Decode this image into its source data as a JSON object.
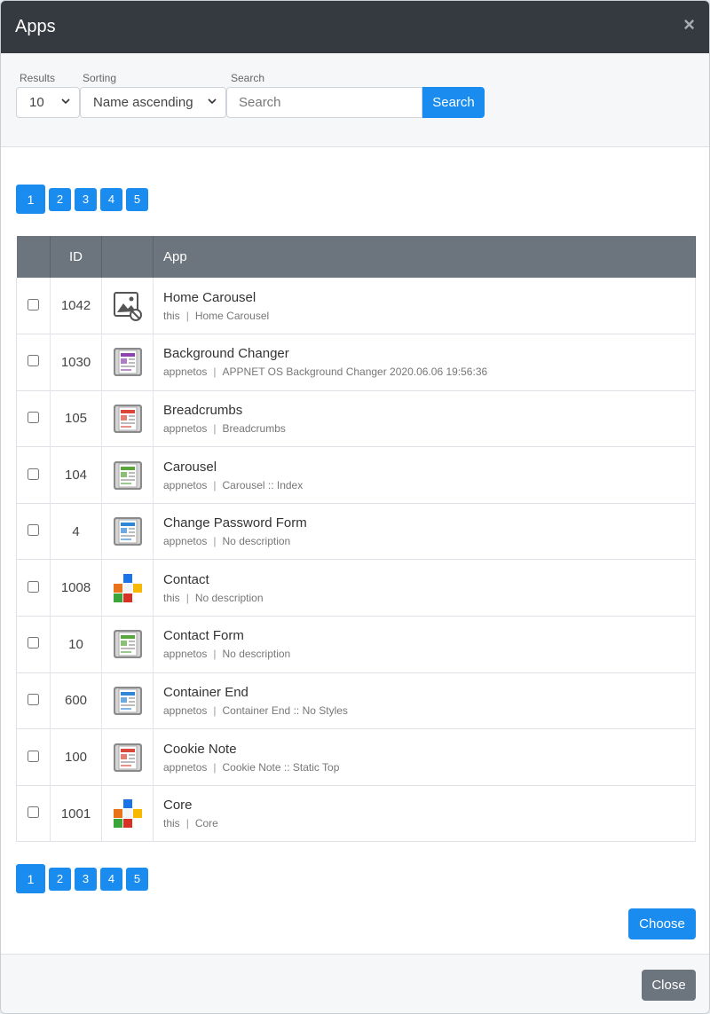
{
  "modal": {
    "title": "Apps",
    "close_glyph": "×"
  },
  "filters": {
    "results_label": "Results",
    "results_value": "10",
    "sorting_label": "Sorting",
    "sorting_value": "Name ascending",
    "search_label": "Search",
    "search_placeholder": "Search",
    "search_button": "Search"
  },
  "pagination": {
    "pages": [
      "1",
      "2",
      "3",
      "4",
      "5"
    ],
    "current": "1"
  },
  "table": {
    "headers": {
      "select": "",
      "id": "ID",
      "icon": "",
      "app": "App"
    },
    "separator": "|",
    "rows": [
      {
        "id": "1042",
        "name": "Home Carousel",
        "vendor": "this",
        "description": "Home Carousel",
        "icon": "image-missing-icon"
      },
      {
        "id": "1030",
        "name": "Background Changer",
        "vendor": "appnetos",
        "description": "APPNET OS Background Changer 2020.06.06 19:56:36",
        "icon": "app-purple-icon"
      },
      {
        "id": "105",
        "name": "Breadcrumbs",
        "vendor": "appnetos",
        "description": "Breadcrumbs",
        "icon": "app-red-icon"
      },
      {
        "id": "104",
        "name": "Carousel",
        "vendor": "appnetos",
        "description": "Carousel :: Index",
        "icon": "app-green-icon"
      },
      {
        "id": "4",
        "name": "Change Password Form",
        "vendor": "appnetos",
        "description": "No description",
        "icon": "app-blue-icon"
      },
      {
        "id": "1008",
        "name": "Contact",
        "vendor": "this",
        "description": "No description",
        "icon": "mosaic-icon"
      },
      {
        "id": "10",
        "name": "Contact Form",
        "vendor": "appnetos",
        "description": "No description",
        "icon": "app-green-icon"
      },
      {
        "id": "600",
        "name": "Container End",
        "vendor": "appnetos",
        "description": "Container End :: No Styles",
        "icon": "app-blue-icon"
      },
      {
        "id": "100",
        "name": "Cookie Note",
        "vendor": "appnetos",
        "description": "Cookie Note :: Static Top",
        "icon": "app-red-icon"
      },
      {
        "id": "1001",
        "name": "Core",
        "vendor": "this",
        "description": "Core",
        "icon": "mosaic-icon"
      }
    ]
  },
  "actions": {
    "choose": "Choose",
    "close": "Close"
  },
  "colors": {
    "header_bg": "#343a40",
    "primary": "#1a8cf0",
    "secondary": "#6c757d"
  }
}
